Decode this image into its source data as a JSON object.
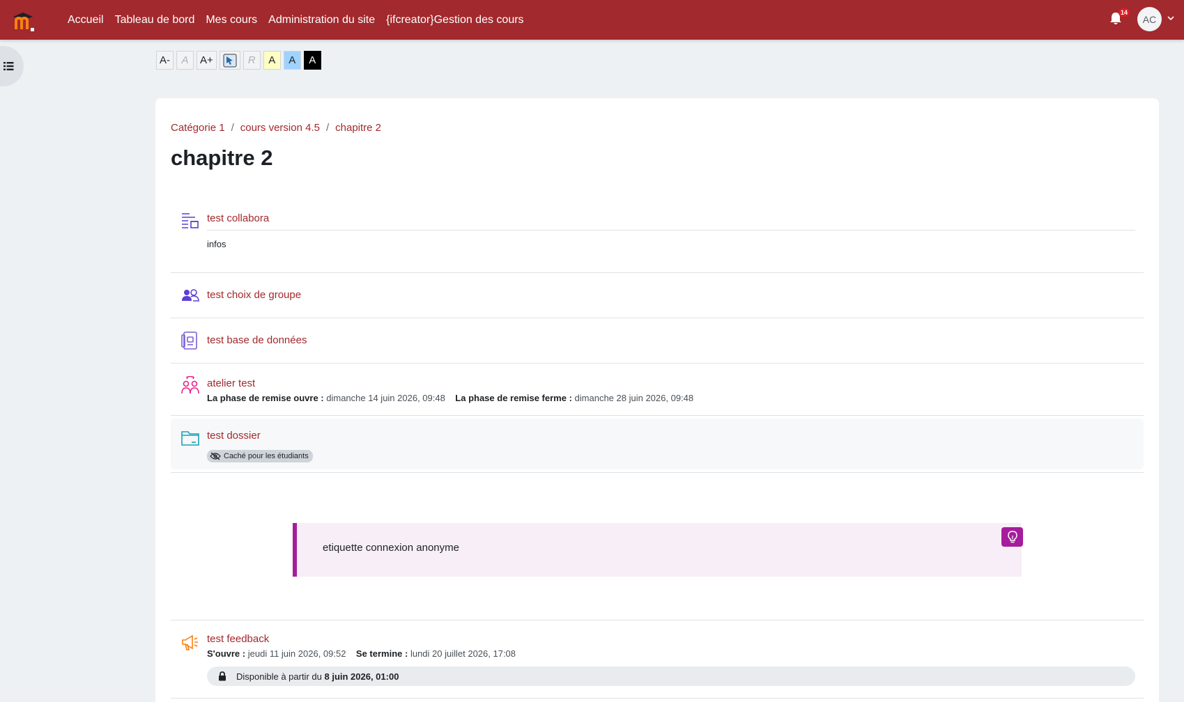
{
  "nav": {
    "links": [
      "Accueil",
      "Tableau de bord",
      "Mes cours",
      "Administration du site",
      "{ifcreator}Gestion des cours"
    ],
    "notification_count": "14",
    "user_initials": "AC",
    "brand_color": "#a2292d"
  },
  "a11y": {
    "buttons": [
      "A-",
      "A",
      "A+",
      "",
      "R",
      "A",
      "A",
      "A"
    ]
  },
  "breadcrumb": [
    "Catégorie 1",
    "cours version 4.5",
    "chapitre 2"
  ],
  "page_title": "chapitre 2",
  "activities": {
    "collabora": {
      "name": "test collabora",
      "desc": "infos",
      "icon": "collabora-icon"
    },
    "choice": {
      "name": "test choix de groupe",
      "icon": "group-choice-icon"
    },
    "database": {
      "name": "test base de données",
      "icon": "database-icon"
    },
    "workshop": {
      "name": "atelier test",
      "icon": "workshop-icon",
      "open_label": "La phase de remise ouvre :",
      "open_value": "dimanche 14 juin 2026, 09:48",
      "close_label": "La phase de remise ferme :",
      "close_value": "dimanche 28 juin 2026, 09:48"
    },
    "folder": {
      "name": "test dossier",
      "icon": "folder-icon",
      "badge": "Caché pour les étudiants"
    },
    "label": {
      "text": "etiquette connexion anonyme",
      "icon": "lightbulb-icon"
    },
    "feedback": {
      "name": "test feedback",
      "icon": "megaphone-icon",
      "open_label": "S'ouvre :",
      "open_value": "jeudi 11 juin 2026, 09:52",
      "close_label": "Se termine :",
      "close_value": "lundi 20 juillet 2026, 17:08",
      "restriction_prefix": "Disponible à partir du",
      "restriction_date": "8 juin 2026, 01:00"
    }
  }
}
